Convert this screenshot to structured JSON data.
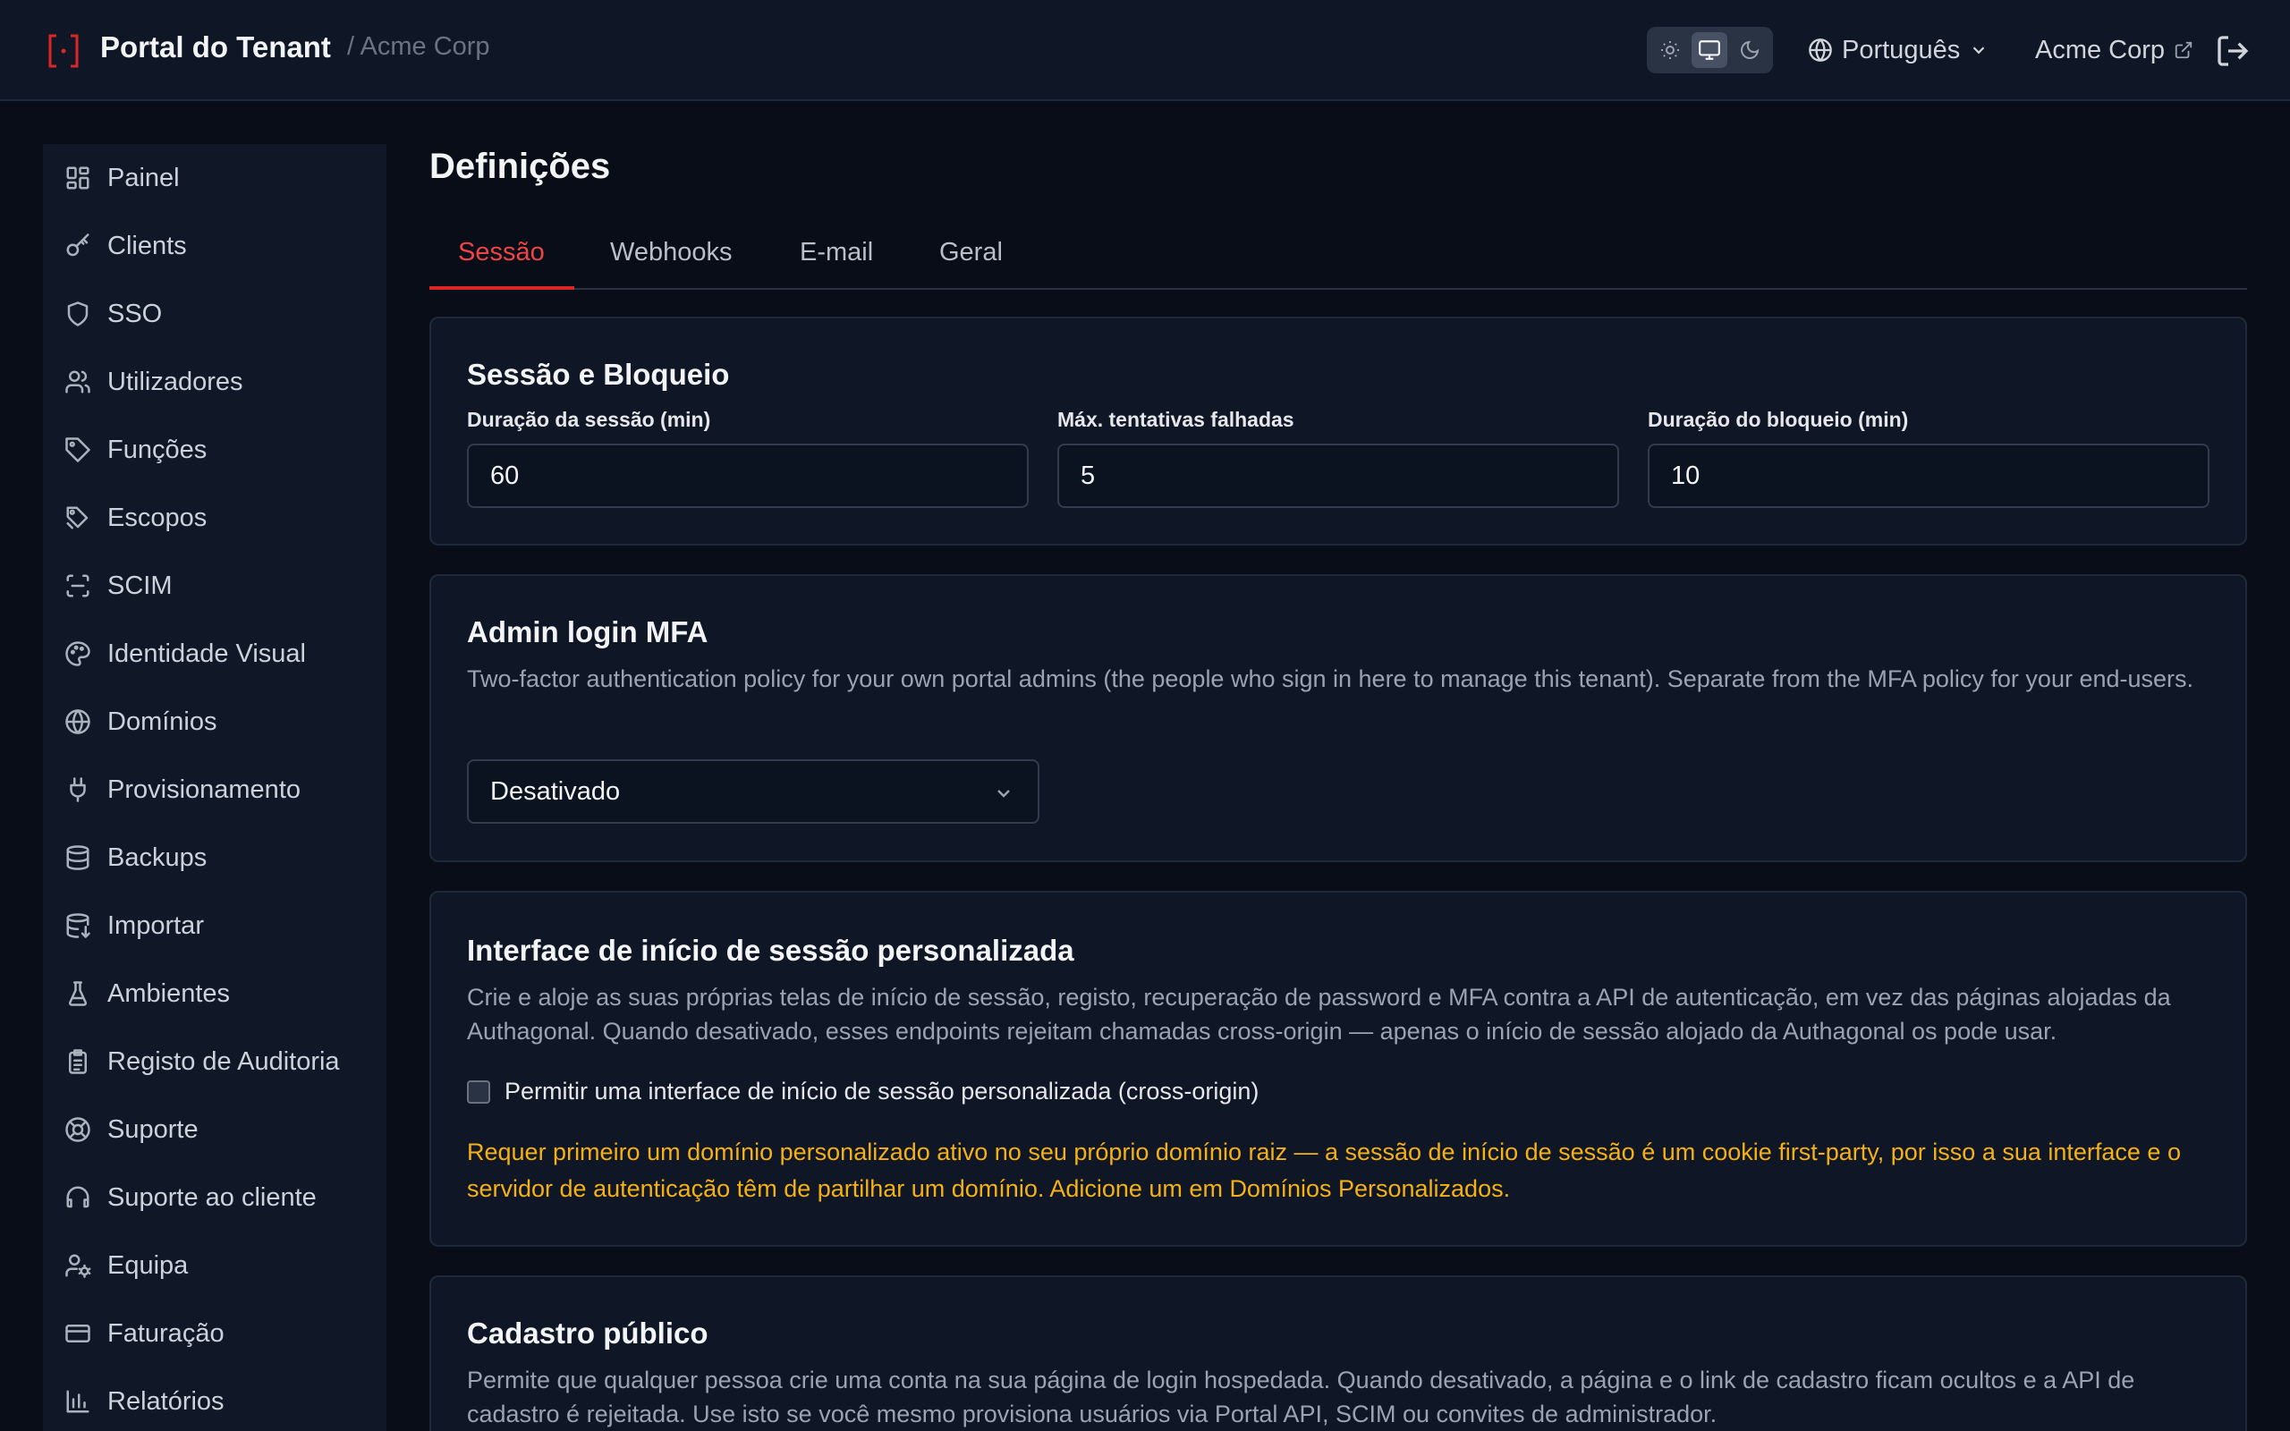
{
  "header": {
    "brand": "Portal do Tenant",
    "tenant_crumb": "/ Acme Corp",
    "theme_options": [
      "light-icon",
      "monitor-icon",
      "moon-icon"
    ],
    "theme_active": "monitor-icon",
    "language": "Português",
    "account": "Acme Corp"
  },
  "colors": {
    "accent": "#dc2626",
    "warning": "#f5b014",
    "background": "#080d18",
    "card": "#0f1726"
  },
  "sidebar": {
    "items": [
      {
        "label": "Painel",
        "icon": "dashboard-icon"
      },
      {
        "label": "Clients",
        "icon": "key-icon"
      },
      {
        "label": "SSO",
        "icon": "shield-icon"
      },
      {
        "label": "Utilizadores",
        "icon": "users-icon"
      },
      {
        "label": "Funções",
        "icon": "tag-icon"
      },
      {
        "label": "Escopos",
        "icon": "tags-icon"
      },
      {
        "label": "SCIM",
        "icon": "scan-icon"
      },
      {
        "label": "Identidade Visual",
        "icon": "palette-icon"
      },
      {
        "label": "Domínios",
        "icon": "globe-icon"
      },
      {
        "label": "Provisionamento",
        "icon": "plug-icon"
      },
      {
        "label": "Backups",
        "icon": "database-icon"
      },
      {
        "label": "Importar",
        "icon": "database-import-icon"
      },
      {
        "label": "Ambientes",
        "icon": "flask-icon"
      },
      {
        "label": "Registo de Auditoria",
        "icon": "clipboard-icon"
      },
      {
        "label": "Suporte",
        "icon": "life-buoy-icon"
      },
      {
        "label": "Suporte ao cliente",
        "icon": "headset-icon"
      },
      {
        "label": "Equipa",
        "icon": "user-cog-icon"
      },
      {
        "label": "Faturação",
        "icon": "credit-card-icon"
      },
      {
        "label": "Relatórios",
        "icon": "bar-chart-icon"
      }
    ]
  },
  "main": {
    "title": "Definições",
    "tabs": [
      {
        "label": "Sessão",
        "active": true
      },
      {
        "label": "Webhooks",
        "active": false
      },
      {
        "label": "E-mail",
        "active": false
      },
      {
        "label": "Geral",
        "active": false
      }
    ],
    "session": {
      "title": "Sessão e Bloqueio",
      "fields": [
        {
          "label": "Duração da sessão (min)",
          "value": "60"
        },
        {
          "label": "Máx. tentativas falhadas",
          "value": "5"
        },
        {
          "label": "Duração do bloqueio (min)",
          "value": "10"
        }
      ]
    },
    "mfa": {
      "title": "Admin login MFA",
      "description": "Two-factor authentication policy for your own portal admins (the people who sign in here to manage this tenant). Separate from the MFA policy for your end-users.",
      "selected": "Desativado"
    },
    "custom_login": {
      "title": "Interface de início de sessão personalizada",
      "description": "Crie e aloje as suas próprias telas de início de sessão, registo, recuperação de password e MFA contra a API de autenticação, em vez das páginas alojadas da Authagonal. Quando desativado, esses endpoints rejeitam chamadas cross-origin — apenas o início de sessão alojado da Authagonal os pode usar.",
      "checkbox_label": "Permitir uma interface de início de sessão personalizada (cross-origin)",
      "checked": false,
      "warning": "Requer primeiro um domínio personalizado ativo no seu próprio domínio raiz — a sessão de início de sessão é um cookie first-party, por isso a sua interface e o servidor de autenticação têm de partilhar um domínio. Adicione um em Domínios Personalizados."
    },
    "public_signup": {
      "title": "Cadastro público",
      "description": "Permite que qualquer pessoa crie uma conta na sua página de login hospedada. Quando desativado, a página e o link de cadastro ficam ocultos e a API de cadastro é rejeitada. Use isto se você mesmo provisiona usuários via Portal API, SCIM ou convites de administrador."
    }
  }
}
